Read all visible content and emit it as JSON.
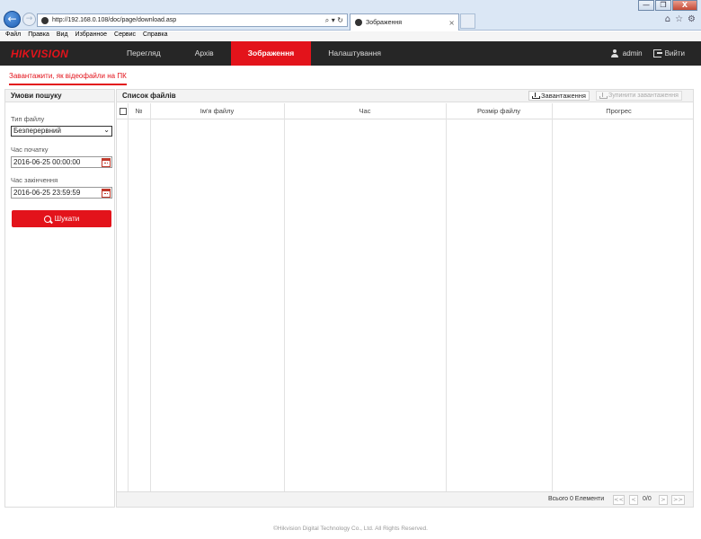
{
  "browser": {
    "url": "http://192.168.0.108/doc/page/download.asp",
    "tab_title": "Зображення",
    "menu": [
      "Файл",
      "Правка",
      "Вид",
      "Избранное",
      "Сервис",
      "Справка"
    ],
    "window_buttons": {
      "minimize": "—",
      "restore": "❐",
      "close": "X"
    },
    "addr_tools": "⌕ ▾ ↻",
    "tab_close": "×",
    "right_icons": [
      "⌂",
      "☆",
      "⚙"
    ]
  },
  "header": {
    "logo": "HIKVISION",
    "nav": [
      {
        "label": "Перегляд",
        "active": false
      },
      {
        "label": "Архів",
        "active": false
      },
      {
        "label": "Зображення",
        "active": true
      },
      {
        "label": "Налаштування",
        "active": false
      }
    ],
    "user": "admin",
    "logout": "Вийти"
  },
  "subtab": "Завантажити, як відеофайли на ПК",
  "search": {
    "title": "Умови пошуку",
    "file_type_label": "Тип файлу",
    "file_type_value": "Безперервний",
    "start_label": "Час початку",
    "start_value": "2016-06-25 00:00:00",
    "end_label": "Час закінчення",
    "end_value": "2016-06-25 23:59:59",
    "button": "Шукати"
  },
  "files": {
    "title": "Список файлів",
    "download_btn": "Завантаження",
    "stop_btn": "Зупинити завантаження",
    "columns": [
      "№",
      "Ім'я файлу",
      "Час",
      "Розмір файлу",
      "Прогрес"
    ],
    "rows": [],
    "total": "Всього 0 Елементи",
    "page": "0/0",
    "pager": {
      "first": "<<",
      "prev": "<",
      "next": ">",
      "last": ">>"
    }
  },
  "footer": "©Hikvision Digital Technology Co., Ltd. All Rights Reserved."
}
